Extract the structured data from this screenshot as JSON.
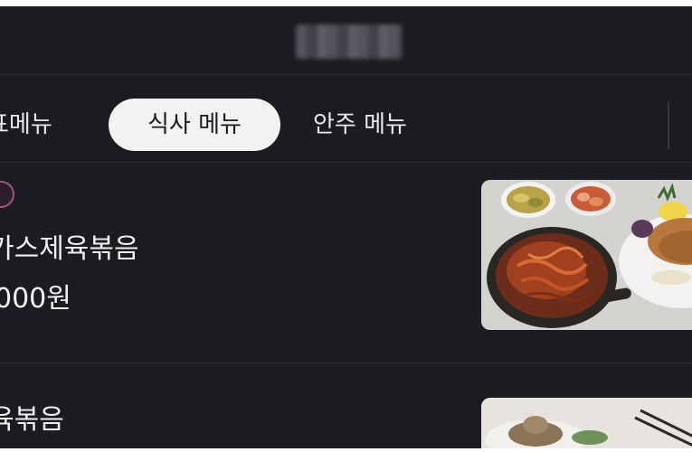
{
  "tabs": [
    {
      "label": "표메뉴",
      "selected": false
    },
    {
      "label": "식사 메뉴",
      "selected": true
    },
    {
      "label": "안주 메뉴",
      "selected": false
    }
  ],
  "menu_items": [
    {
      "name": "가스제육볶음",
      "price": "000원",
      "has_badge": true
    },
    {
      "name": "육볶음",
      "price": "",
      "has_badge": false
    }
  ],
  "colors": {
    "background": "#1d1b22",
    "selected_tab": "#f2f2f2",
    "text": "#f0eff2",
    "badge_border": "#a4537a"
  }
}
